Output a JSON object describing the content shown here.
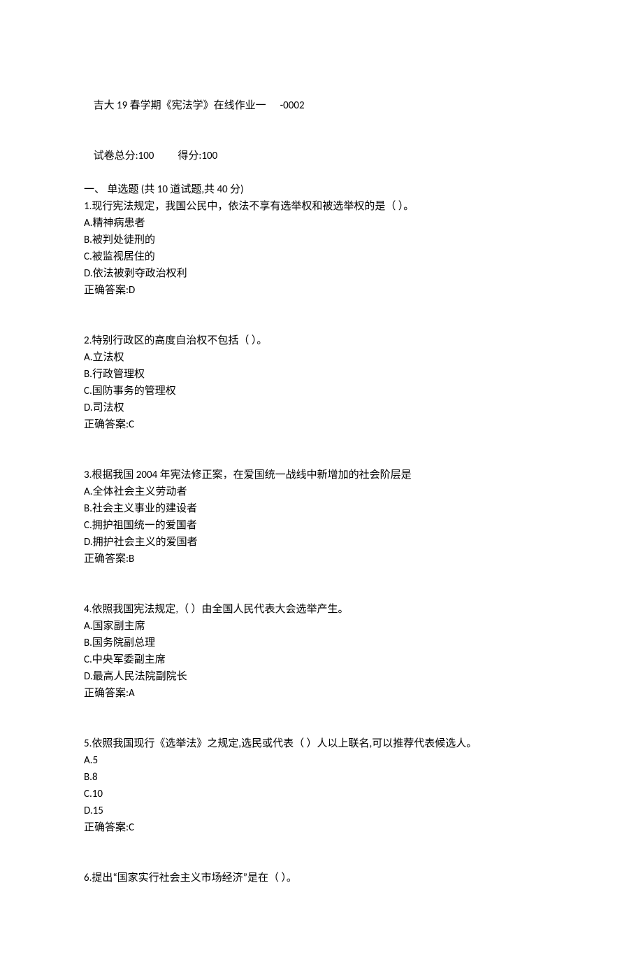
{
  "header": {
    "title_prefix": "吉大 19 春学期《宪法学》在线作业一",
    "title_suffix": "-0002",
    "score_prefix": "试卷总分:100",
    "score_suffix": "得分:100",
    "section": "一、 单选题 (共 10 道试题,共 40 分)"
  },
  "questions": [
    {
      "stem": "1.现行宪法规定，我国公民中，依法不享有选举权和被选举权的是（ ）。",
      "opts": [
        "A.精神病患者",
        "B.被判处徒刑的",
        "C.被监视居住的",
        "D.依法被剥夺政治权利"
      ],
      "ans": "正确答案:D"
    },
    {
      "stem": "2.特别行政区的高度自治权不包括（ ）。",
      "opts": [
        "A.立法权",
        "B.行政管理权",
        "C.国防事务的管理权",
        "D.司法权"
      ],
      "ans": "正确答案:C"
    },
    {
      "stem": "3.根据我国 2004 年宪法修正案，在爱国统一战线中新增加的社会阶层是",
      "opts": [
        "A.全体社会主义劳动者",
        "B.社会主义事业的建设者",
        "C.拥护祖国统一的爱国者",
        "D.拥护社会主义的爱国者"
      ],
      "ans": "正确答案:B"
    },
    {
      "stem": "4.依照我国宪法规定,（ ）由全国人民代表大会选举产生。",
      "opts": [
        "A.国家副主席",
        "B.国务院副总理",
        "C.中央军委副主席",
        "D.最高人民法院副院长"
      ],
      "ans": "正确答案:A"
    },
    {
      "stem": "5.依照我国现行《选举法》之规定,选民或代表（ ）人以上联名,可以推荐代表候选人。",
      "opts": [
        "A.5",
        "B.8",
        "C.10",
        "D.15"
      ],
      "ans": "正确答案:C"
    },
    {
      "stem": "6.提出“国家实行社会主义市场经济”是在（ ）。",
      "opts": [],
      "ans": ""
    }
  ]
}
